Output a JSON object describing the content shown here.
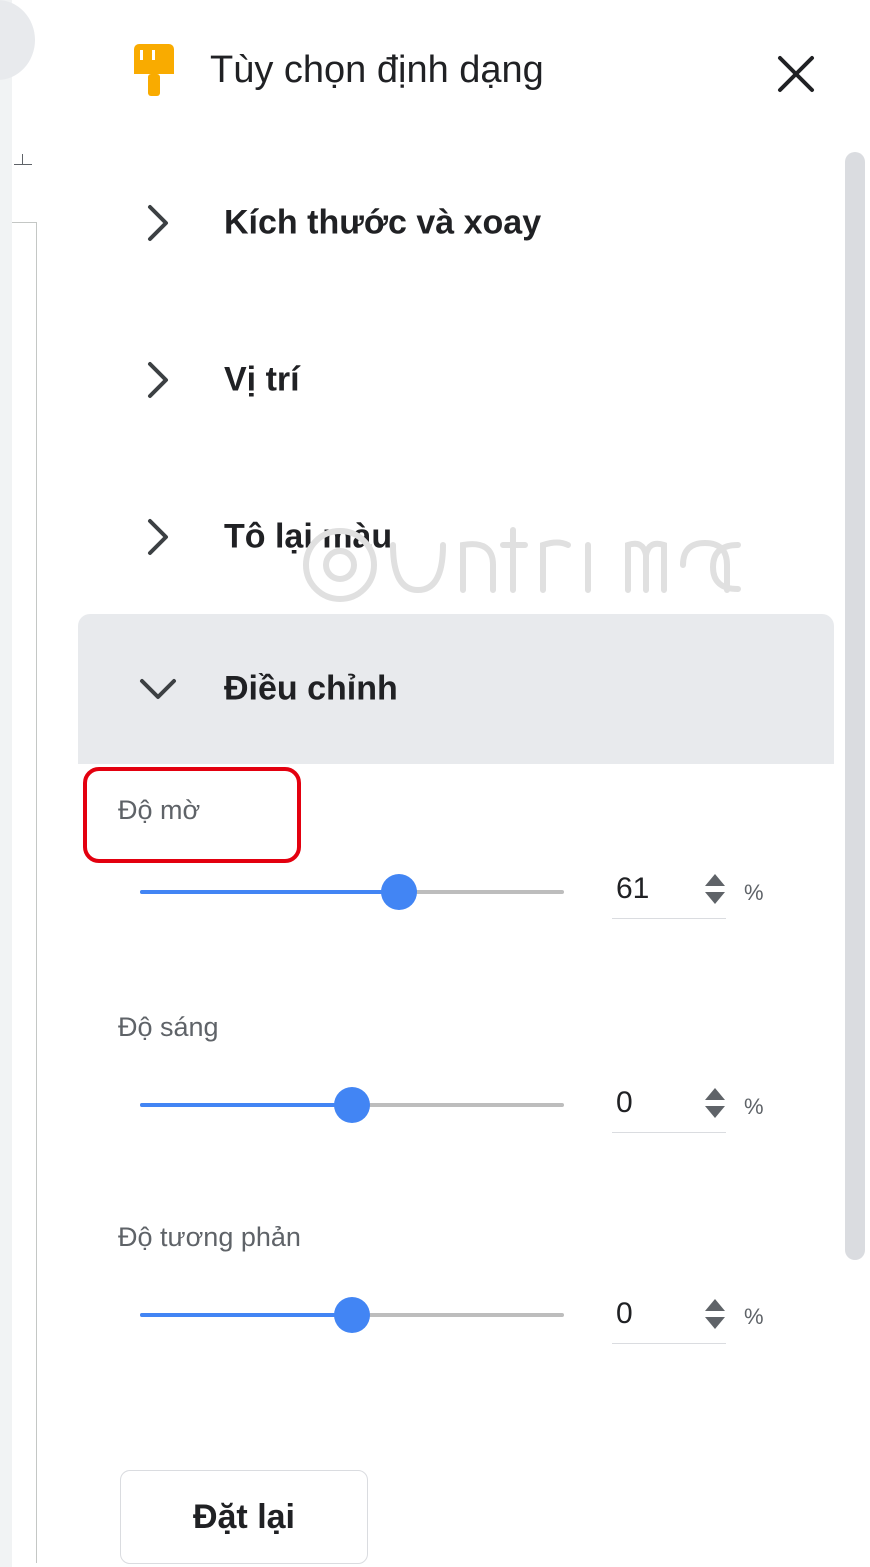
{
  "panel": {
    "title": "Tùy chọn định dạng",
    "icon": "paint-roller-icon",
    "close_icon": "close-icon"
  },
  "sections": [
    {
      "label": "Kích thước và xoay",
      "expanded": false
    },
    {
      "label": "Vị trí",
      "expanded": false
    },
    {
      "label": "Tô lại màu",
      "expanded": false
    },
    {
      "label": "Điều chỉnh",
      "expanded": true
    }
  ],
  "adjustments": {
    "transparency": {
      "label": "Độ mờ",
      "value": "61",
      "unit": "%",
      "slider_fraction": 0.61
    },
    "brightness": {
      "label": "Độ sáng",
      "value": "0",
      "unit": "%",
      "slider_fraction": 0.5
    },
    "contrast": {
      "label": "Độ tương phản",
      "value": "0",
      "unit": "%",
      "slider_fraction": 0.5
    }
  },
  "reset_label": "Đặt lại",
  "colors": {
    "accent": "#4285f4",
    "highlight": "#e3000f",
    "icon_yellow": "#f9ab00"
  }
}
